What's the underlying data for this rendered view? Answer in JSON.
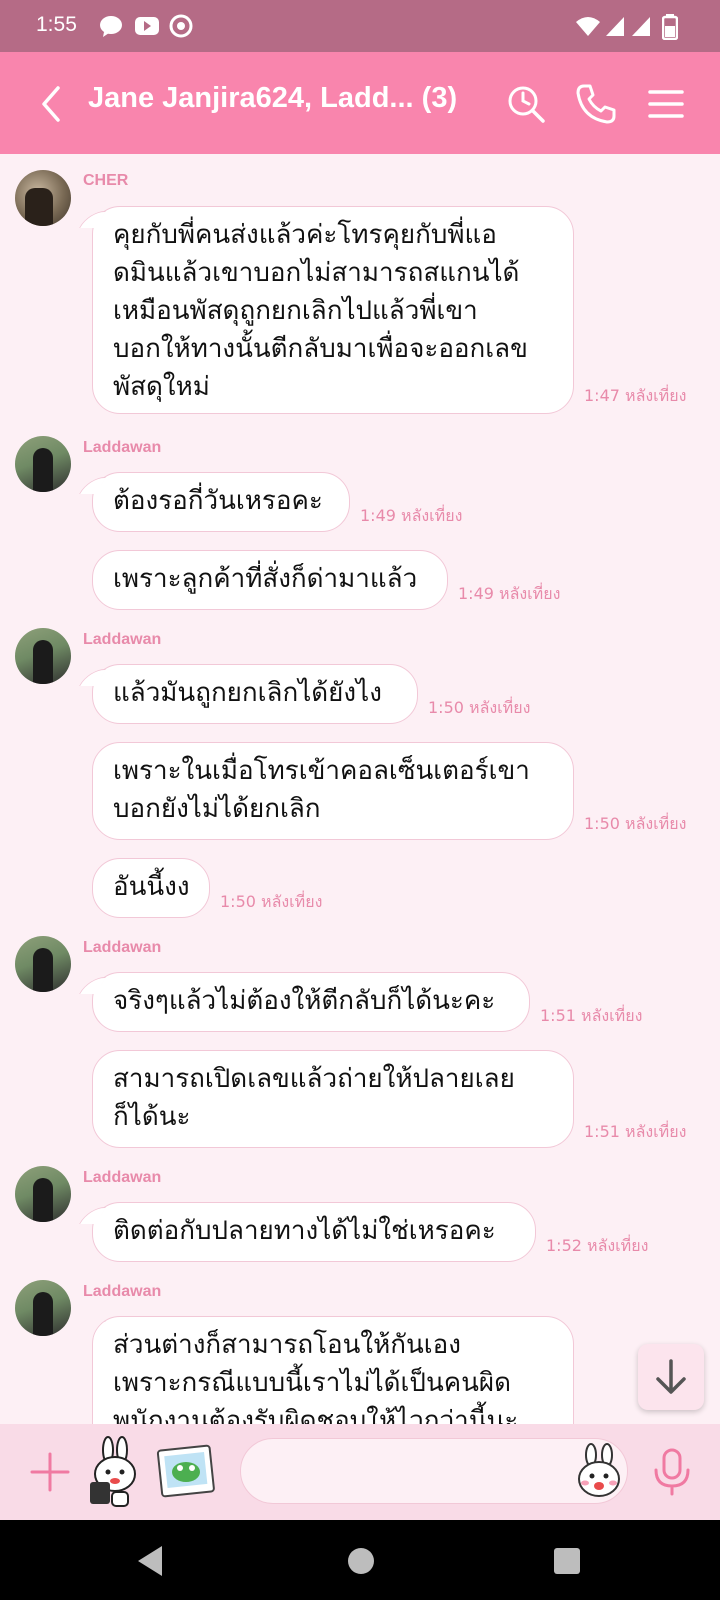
{
  "status_bar": {
    "time": "1:55"
  },
  "header": {
    "title": "Jane Janjira624, Ladd... (3)"
  },
  "messages": [
    {
      "sender": "CHER",
      "lines": [
        "คุยกับพี่คนส่งแล้วค่ะโทรคุยกับพี่แอ",
        "ดมินแล้วเขาบอกไม่สามารถสแกนได้",
        "เหมือนพัสดุถูกยกเลิกไปแล้วพี่เขา",
        "บอกให้ทางนั้นตีกลับมาเพื่อจะออกเลข",
        "พัสดุใหม่"
      ],
      "time": "1:47 หลังเที่ยง"
    },
    {
      "sender": "Laddawan",
      "lines": [
        "ต้องรอกี่วันเหรอคะ"
      ],
      "time": "1:49 หลังเที่ยง"
    },
    {
      "lines": [
        "เพราะลูกค้าที่สั่งก็ด่ามาแล้ว"
      ],
      "time": "1:49 หลังเที่ยง"
    },
    {
      "sender": "Laddawan",
      "lines": [
        "แล้วมันถูกยกเลิกได้ยังไง"
      ],
      "time": "1:50 หลังเที่ยง"
    },
    {
      "lines": [
        "เพราะในเมื่อโทรเข้าคอลเซ็นเตอร์เขา",
        "บอกยังไม่ได้ยกเลิก"
      ],
      "time": "1:50 หลังเที่ยง"
    },
    {
      "lines": [
        "อันนี้งง"
      ],
      "time": "1:50 หลังเที่ยง"
    },
    {
      "sender": "Laddawan",
      "lines": [
        "จริงๆแล้วไม่ต้องให้ตีกลับก็ได้นะคะ"
      ],
      "time": "1:51 หลังเที่ยง"
    },
    {
      "lines": [
        "สามารถเปิดเลขแล้วถ่ายให้ปลายเลย",
        "ก็ได้นะ"
      ],
      "time": "1:51 หลังเที่ยง"
    },
    {
      "sender": "Laddawan",
      "lines": [
        "ติดต่อกับปลายทางได้ไม่ใช่เหรอคะ"
      ],
      "time": "1:52 หลังเที่ยง"
    },
    {
      "sender": "Laddawan",
      "lines": [
        "ส่วนต่างก็สามารถโอนให้กันเอง",
        "เพราะกรณีแบบนี้เราไม่ได้เป็นคนผิด",
        "พนักงานต้องรับผิดชอบให้ไวกว่านี้นะ"
      ]
    }
  ],
  "icons": {
    "back": "chevron-left-icon",
    "search": "search-clock-icon",
    "call": "phone-icon",
    "menu": "hamburger-menu-icon",
    "scroll_down": "arrow-down-icon",
    "add": "plus-icon",
    "sticker": "sticker-icon",
    "image": "gallery-icon",
    "emoji": "emoji-icon",
    "mic": "microphone-icon"
  },
  "colors": {
    "header": "#f985ad",
    "status_bar": "#b56b86",
    "accent": "#e88aaa",
    "chat_bg": "#fdf0f5",
    "input_bar": "#f9dbe7"
  }
}
